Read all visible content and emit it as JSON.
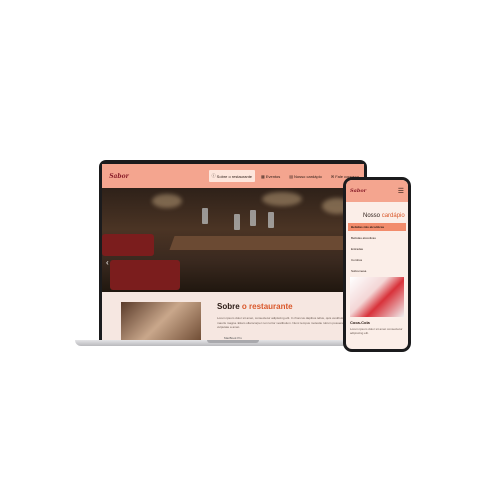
{
  "laptop": {
    "label": "MacBook Pro",
    "site": {
      "logo_text": "Sabor",
      "nav": [
        {
          "label": "Sobre o restaurante",
          "icon": "info-icon"
        },
        {
          "label": "Eventos",
          "icon": "calendar-icon"
        },
        {
          "label": "Nosso cardápio",
          "icon": "menu-book-icon"
        },
        {
          "label": "Fale conosco",
          "icon": "chat-icon"
        }
      ],
      "about": {
        "title_prefix": "Sobre",
        "title_accent": "o restaurante",
        "text": "Lorem ipsum dolor sit amet, consectetur adipiscing elit. In rhoncus dapibus tellus, quis vestibulum sed mauris magna. Etiam ullamcorper non tortor vestibulum. Nunc tempus molestie rutrum posuere dictum, vulputate a amet."
      }
    }
  },
  "phone": {
    "logo_text": "Sabor",
    "menu_title_prefix": "Nosso",
    "menu_title_accent": "cardápio",
    "categories": [
      {
        "label": "Bebidas não alcoólicas",
        "active": true
      },
      {
        "label": "Bebidas alcoólicas",
        "active": false
      },
      {
        "label": "Entradas",
        "active": false
      },
      {
        "label": "Combos",
        "active": false
      },
      {
        "label": "Sobremesa",
        "active": false
      }
    ],
    "item": {
      "title": "Coca-Cola",
      "text": "Lorem ipsum dolor sit amet consectetur adipiscing elit."
    }
  },
  "colors": {
    "header": "#f4a58f",
    "accent": "#d9582b",
    "active_row": "#f28c6c",
    "page_bg": "#f6e7e1"
  }
}
